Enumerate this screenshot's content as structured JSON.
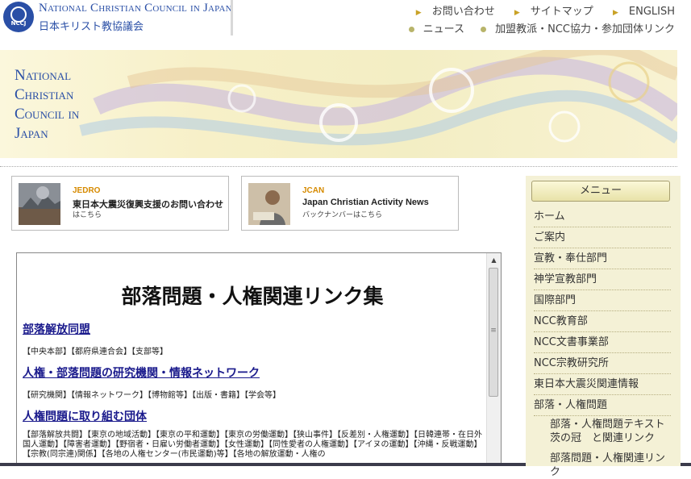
{
  "header": {
    "org_name_en": "National Christian Council in Japan",
    "org_name_jp": "日本キリスト教協議会",
    "logo_text": "NCCJ",
    "top_links": [
      "お問い合わせ",
      "サイトマップ",
      "ENGLISH"
    ],
    "sub_links": [
      "ニュース",
      "加盟教派・NCC協力・参加団体リンク"
    ]
  },
  "banner": {
    "lines": [
      "National",
      "Christian",
      "Council in",
      "Japan"
    ]
  },
  "cards": [
    {
      "tag": "JEDRO",
      "title": "東日本大震災復興支援のお問い合わせ",
      "sub": "はこちら"
    },
    {
      "tag": "JCAN",
      "title": "Japan Christian Activity News",
      "sub": "バックナンバーはこちら"
    }
  ],
  "main": {
    "title": "部落問題・人権関連リンク集",
    "sections": [
      {
        "heading": "部落解放同盟",
        "items": "【中央本部】【都府県連合会】【支部等】"
      },
      {
        "heading": "人権・部落問題の研究機関・情報ネットワーク",
        "items": "【研究機関】【情報ネットワーク】【博物館等】【出版・書籍】【学会等】"
      },
      {
        "heading": "人権問題に取り組む団体",
        "items": "【部落解放共闘】【東京の地域活動】【東京の平和運動】【東京の労働運動】【狭山事件】【反差別・人権運動】【日韓連帯・在日外国人運動】【障害者運動】【野宿者・日雇い労働者運動】【女性運動】【同性愛者の人権運動】【アイヌの運動】【沖縄・反戦運動】【宗教(同宗連)関係】【各地の人権センター(市民運動)等】【各地の解放運動・人権の"
      }
    ]
  },
  "sidebar": {
    "menu_title": "メニュー",
    "items": [
      "ホーム",
      "ご案内",
      "宣教・奉仕部門",
      "神学宣教部門",
      "国際部門",
      "NCC教育部",
      "NCC文書事業部",
      "NCC宗教研究所",
      "東日本大震災関連情報",
      "部落・人権問題"
    ],
    "subitems": [
      "部落・人権問題テキスト 茨の冠　と関連リンク",
      "部落問題・人権関連リンク"
    ]
  }
}
